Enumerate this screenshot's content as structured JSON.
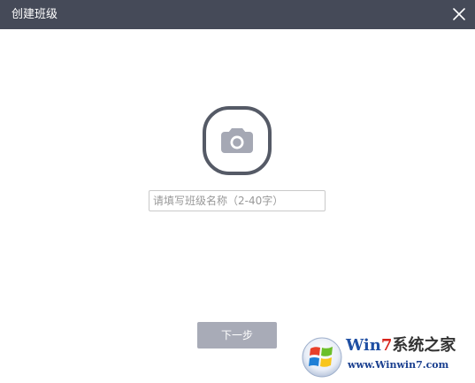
{
  "window": {
    "title": "创建班级"
  },
  "titlebar": {
    "background_color": "#454a58",
    "close_icon": "close-icon"
  },
  "avatar": {
    "icon": "camera-icon",
    "ring_color": "#555a66",
    "icon_color": "#a5a8b4"
  },
  "class_name_input": {
    "value": "",
    "placeholder": "请填写班级名称（2-40字）"
  },
  "next_button": {
    "label": "下一步",
    "background_color": "#a8abb7"
  },
  "watermark": {
    "brand_prefix": "Win",
    "brand_seven": "7",
    "brand_cn": "系统之家",
    "url": "www.Winwin7.com"
  }
}
